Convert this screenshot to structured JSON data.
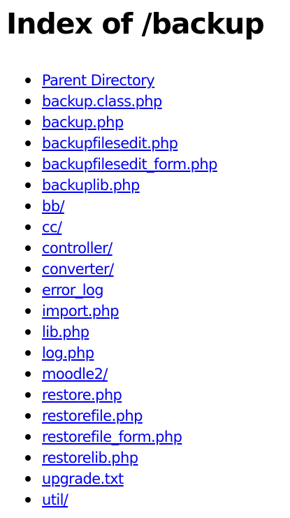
{
  "page": {
    "title": "Index of /backup",
    "link_color": "#0000ee",
    "text_color": "#000000",
    "background": "#ffffff"
  },
  "listing": {
    "items": [
      {
        "label": "Parent Directory"
      },
      {
        "label": "backup.class.php"
      },
      {
        "label": "backup.php"
      },
      {
        "label": "backupfilesedit.php"
      },
      {
        "label": "backupfilesedit_form.php"
      },
      {
        "label": "backuplib.php"
      },
      {
        "label": "bb/"
      },
      {
        "label": "cc/"
      },
      {
        "label": "controller/"
      },
      {
        "label": "converter/"
      },
      {
        "label": "error_log"
      },
      {
        "label": "import.php"
      },
      {
        "label": "lib.php"
      },
      {
        "label": "log.php"
      },
      {
        "label": "moodle2/"
      },
      {
        "label": "restore.php"
      },
      {
        "label": "restorefile.php"
      },
      {
        "label": "restorefile_form.php"
      },
      {
        "label": "restorelib.php"
      },
      {
        "label": "upgrade.txt"
      },
      {
        "label": "util/"
      }
    ]
  }
}
